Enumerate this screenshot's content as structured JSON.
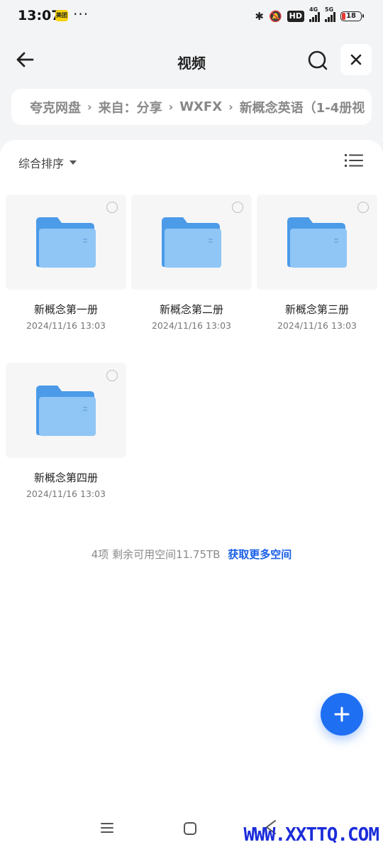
{
  "status_bar": {
    "time": "13:07",
    "app_badge": "美团",
    "more": "···",
    "hd_label": "HD",
    "network_1": "4G",
    "network_2": "5G",
    "battery": "18"
  },
  "header": {
    "title": "视频"
  },
  "breadcrumb": {
    "items": [
      "夸克网盘",
      "来自：分享",
      "WXFX",
      "新概念英语（1-4册视"
    ]
  },
  "toolbar": {
    "sort_label": "综合排序"
  },
  "folders": [
    {
      "name": "新概念第一册",
      "date": "2024/11/16 13:03"
    },
    {
      "name": "新概念第二册",
      "date": "2024/11/16 13:03"
    },
    {
      "name": "新概念第三册",
      "date": "2024/11/16 13:03"
    },
    {
      "name": "新概念第四册",
      "date": "2024/11/16 13:03"
    }
  ],
  "summary": {
    "count": "4项",
    "space": "剩余可用空间11.75TB",
    "link": "获取更多空间"
  },
  "watermark": "WWW.XXTTQ.COM",
  "colors": {
    "accent": "#1f6ff2",
    "link": "#1a5fe6",
    "folder_blue": "#5aa9f0",
    "battery_low": "#e53935"
  }
}
